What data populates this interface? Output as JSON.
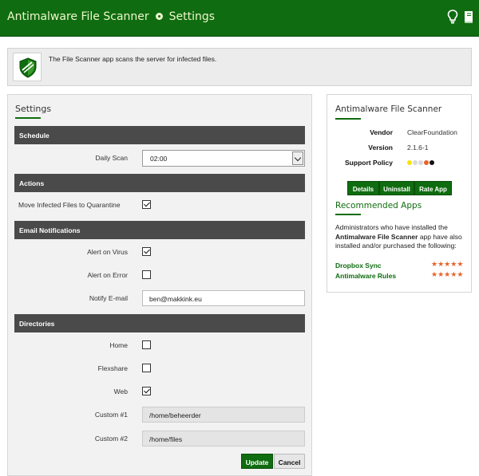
{
  "header": {
    "app_name": "Antimalware File Scanner",
    "page": "Settings",
    "icons": [
      "lightbulb-icon",
      "book-icon"
    ]
  },
  "intro": {
    "text": "The File Scanner app scans the server for infected files.",
    "icon": "shield-icon"
  },
  "settings": {
    "title": "Settings",
    "sections": {
      "schedule": "Schedule",
      "actions": "Actions",
      "email": "Email Notifications",
      "directories": "Directories"
    },
    "daily_scan": {
      "label": "Daily Scan",
      "value": "02:00"
    },
    "move_quarantine": {
      "label": "Move Infected Files to Quarantine",
      "checked": true
    },
    "alert_virus": {
      "label": "Alert on Virus",
      "checked": true
    },
    "alert_error": {
      "label": "Alert on Error",
      "checked": false
    },
    "notify_email": {
      "label": "Notify E-mail",
      "value": "ben@makkink.eu"
    },
    "dir_home": {
      "label": "Home",
      "checked": false
    },
    "dir_flexshare": {
      "label": "Flexshare",
      "checked": false
    },
    "dir_web": {
      "label": "Web",
      "checked": true
    },
    "custom1": {
      "label": "Custom #1",
      "value": "/home/beheerder"
    },
    "custom2": {
      "label": "Custom #2",
      "value": "/home/files"
    },
    "buttons": {
      "update": "Update",
      "cancel": "Cancel"
    }
  },
  "sidebar": {
    "title": "Antimalware File Scanner",
    "vendor_label": "Vendor",
    "vendor_value": "ClearFoundation",
    "version_label": "Version",
    "version_value": "2.1.6-1",
    "support_label": "Support Policy",
    "support_colors": [
      "#f5e400",
      "#d8d8d8",
      "#d8d8d8",
      "#e8632a",
      "#111111"
    ],
    "buttons": {
      "details": "Details",
      "uninstall": "Uninstall",
      "rate": "Rate App"
    },
    "recommended_title": "Recommended Apps",
    "rec_text_before": "Administrators who have installed the ",
    "rec_text_bold": "Antimalware File Scanner",
    "rec_text_after": " app have also installed and/or purchased the following:",
    "recommended": [
      {
        "name": "Dropbox Sync",
        "stars": 5
      },
      {
        "name": "Antimalware Rules",
        "stars": 5
      }
    ]
  },
  "colors": {
    "brand_green": "#0f6c10",
    "section_dark": "#4a4a4a",
    "star_orange": "#e8632a"
  }
}
